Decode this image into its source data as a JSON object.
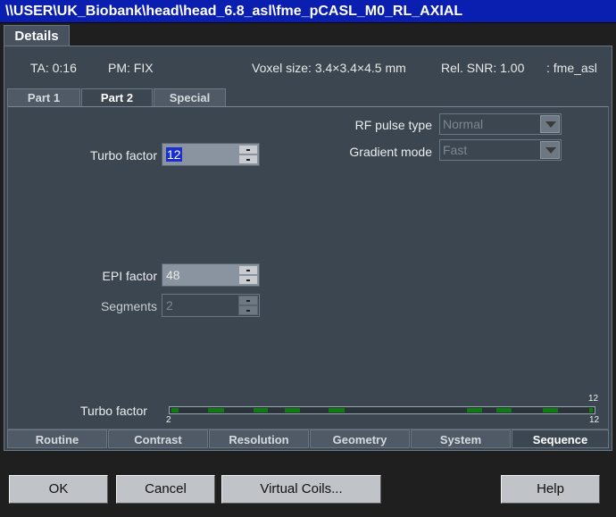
{
  "title": "\\\\USER\\UK_Biobank\\head\\head_6.8_asl\\fme_pCASL_M0_RL_AXIAL",
  "details_tab": "Details",
  "info": {
    "ta": "TA: 0:16",
    "pm": "PM: FIX",
    "voxel": "Voxel size: 3.4×3.4×4.5 mm",
    "snr": "Rel. SNR: 1.00",
    "seq": ": fme_asl"
  },
  "subtabs": [
    {
      "label": "Part 1"
    },
    {
      "label": "Part 2"
    },
    {
      "label": "Special"
    }
  ],
  "fields": {
    "turbo_factor": {
      "label": "Turbo factor",
      "value": "12"
    },
    "epi_factor": {
      "label": "EPI factor",
      "value": "48"
    },
    "segments": {
      "label": "Segments",
      "value": "2"
    },
    "rf_pulse_type": {
      "label": "RF pulse type",
      "value": "Normal"
    },
    "gradient_mode": {
      "label": "Gradient mode",
      "value": "Fast"
    }
  },
  "slider": {
    "label": "Turbo factor",
    "min": "2",
    "max": "12",
    "current": "12",
    "value": 12
  },
  "bottom_tabs": [
    {
      "label": "Routine"
    },
    {
      "label": "Contrast"
    },
    {
      "label": "Resolution"
    },
    {
      "label": "Geometry"
    },
    {
      "label": "System"
    },
    {
      "label": "Sequence"
    }
  ],
  "buttons": {
    "ok": "OK",
    "cancel": "Cancel",
    "virtual_coils": "Virtual Coils...",
    "help": "Help"
  },
  "colors": {
    "titlebar": "#0a1fb0",
    "panel": "#3c4650",
    "selection": "#1a2fd0",
    "slider_segment": "#0f7a0f"
  }
}
